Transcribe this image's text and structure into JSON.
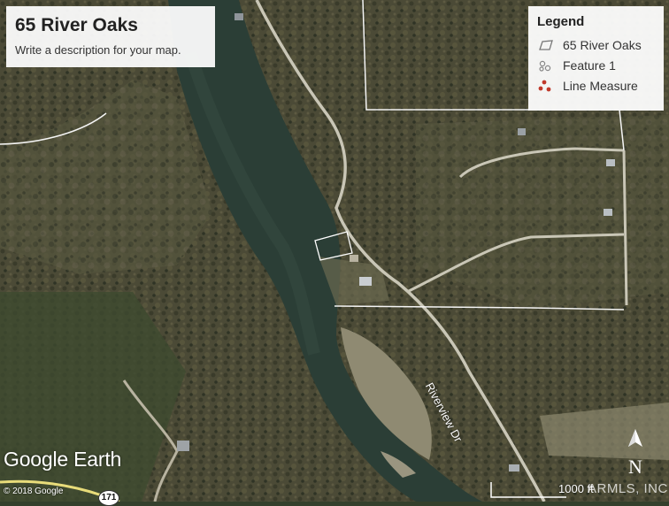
{
  "map": {
    "title": "65 River Oaks",
    "description": "Write a description for your map."
  },
  "legend": {
    "title": "Legend",
    "items": [
      {
        "label": "65 River Oaks",
        "icon": "polygon-icon"
      },
      {
        "label": "Feature 1",
        "icon": "feature-icon"
      },
      {
        "label": "Line Measure",
        "icon": "line-measure-icon"
      }
    ]
  },
  "branding": {
    "logo": "Google Earth",
    "copyright": "© 2018 Google"
  },
  "labels": {
    "road": "Riverview Dr",
    "highway": "171",
    "scale": "1000 ft",
    "watermark": "ARMLS, INC",
    "compass": "N"
  },
  "colors": {
    "water": "#2b3e36",
    "forest": "#4a4a34",
    "property_line": "#ffffff",
    "line_measure_icon": "#c0392b"
  }
}
